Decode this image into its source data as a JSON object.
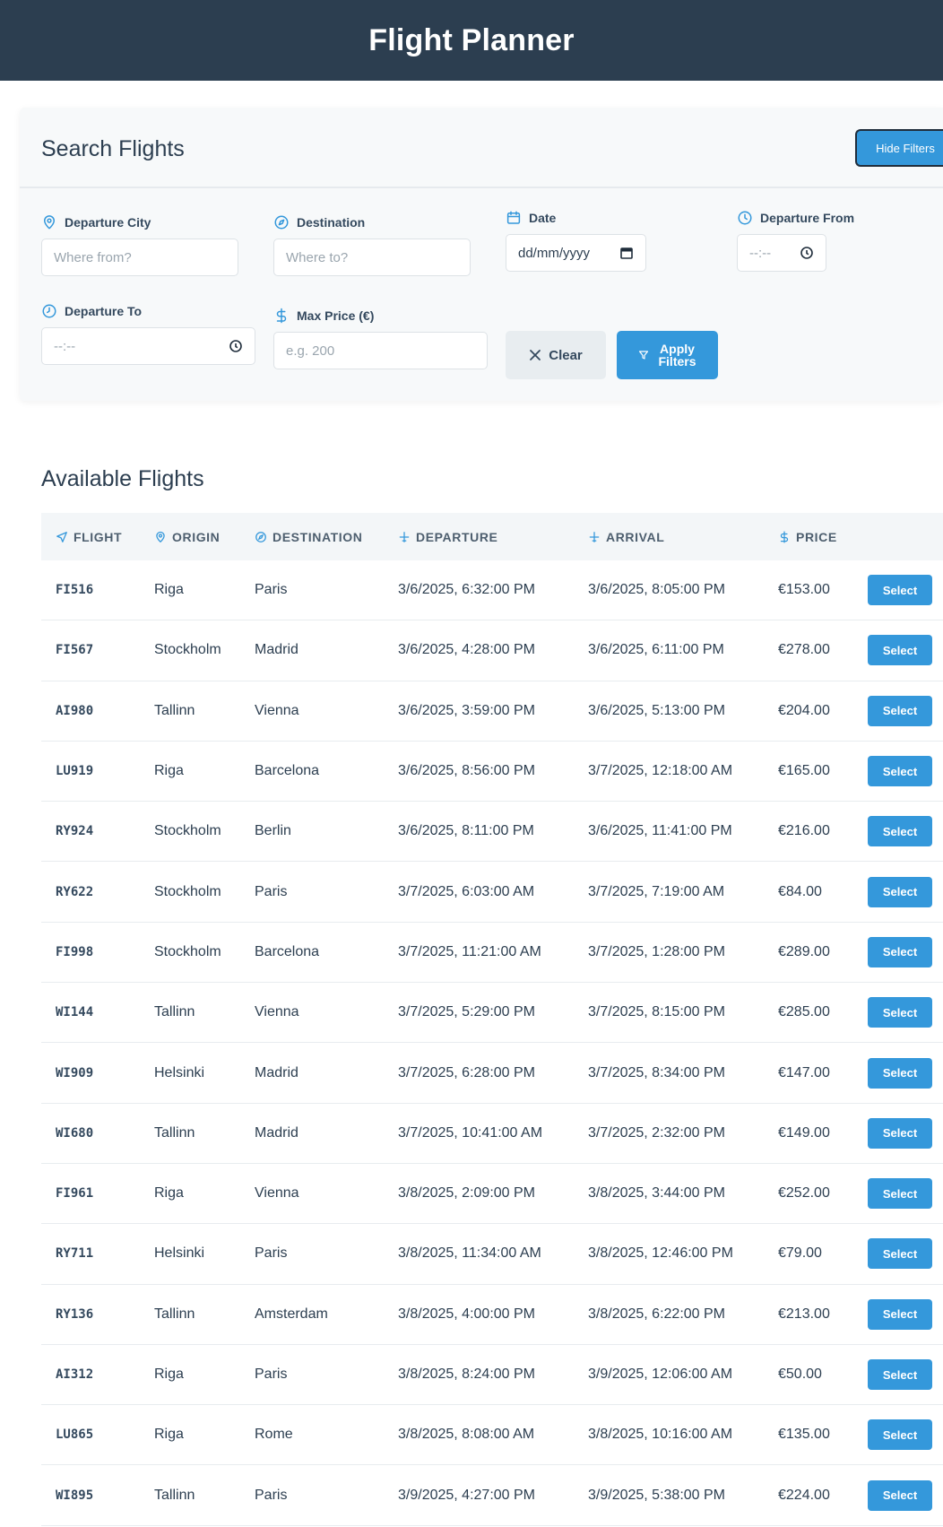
{
  "header": {
    "title": "Flight Planner"
  },
  "search": {
    "title": "Search Flights",
    "toggle_label": "Hide Filters",
    "fields": {
      "departure_city": {
        "label": "Departure City",
        "placeholder": "Where from?"
      },
      "destination": {
        "label": "Destination",
        "placeholder": "Where to?"
      },
      "date": {
        "label": "Date",
        "placeholder": "dd/mm/yyyy"
      },
      "departure_from": {
        "label": "Departure From",
        "placeholder": "--:--"
      },
      "departure_to": {
        "label": "Departure To",
        "placeholder": "--:--"
      },
      "max_price": {
        "label": "Max Price (€)",
        "placeholder": "e.g. 200"
      }
    },
    "clear_label": "Clear",
    "apply_label": "Apply Filters"
  },
  "results": {
    "title": "Available Flights",
    "columns": [
      "FLIGHT",
      "ORIGIN",
      "DESTINATION",
      "DEPARTURE",
      "ARRIVAL",
      "PRICE"
    ],
    "select_label": "Select",
    "rows": [
      {
        "flight": "FI516",
        "origin": "Riga",
        "destination": "Paris",
        "departure": "3/6/2025, 6:32:00 PM",
        "arrival": "3/6/2025, 8:05:00 PM",
        "price": "€153.00"
      },
      {
        "flight": "FI567",
        "origin": "Stockholm",
        "destination": "Madrid",
        "departure": "3/6/2025, 4:28:00 PM",
        "arrival": "3/6/2025, 6:11:00 PM",
        "price": "€278.00"
      },
      {
        "flight": "AI980",
        "origin": "Tallinn",
        "destination": "Vienna",
        "departure": "3/6/2025, 3:59:00 PM",
        "arrival": "3/6/2025, 5:13:00 PM",
        "price": "€204.00"
      },
      {
        "flight": "LU919",
        "origin": "Riga",
        "destination": "Barcelona",
        "departure": "3/6/2025, 8:56:00 PM",
        "arrival": "3/7/2025, 12:18:00 AM",
        "price": "€165.00"
      },
      {
        "flight": "RY924",
        "origin": "Stockholm",
        "destination": "Berlin",
        "departure": "3/6/2025, 8:11:00 PM",
        "arrival": "3/6/2025, 11:41:00 PM",
        "price": "€216.00"
      },
      {
        "flight": "RY622",
        "origin": "Stockholm",
        "destination": "Paris",
        "departure": "3/7/2025, 6:03:00 AM",
        "arrival": "3/7/2025, 7:19:00 AM",
        "price": "€84.00"
      },
      {
        "flight": "FI998",
        "origin": "Stockholm",
        "destination": "Barcelona",
        "departure": "3/7/2025, 11:21:00 AM",
        "arrival": "3/7/2025, 1:28:00 PM",
        "price": "€289.00"
      },
      {
        "flight": "WI144",
        "origin": "Tallinn",
        "destination": "Vienna",
        "departure": "3/7/2025, 5:29:00 PM",
        "arrival": "3/7/2025, 8:15:00 PM",
        "price": "€285.00"
      },
      {
        "flight": "WI909",
        "origin": "Helsinki",
        "destination": "Madrid",
        "departure": "3/7/2025, 6:28:00 PM",
        "arrival": "3/7/2025, 8:34:00 PM",
        "price": "€147.00"
      },
      {
        "flight": "WI680",
        "origin": "Tallinn",
        "destination": "Madrid",
        "departure": "3/7/2025, 10:41:00 AM",
        "arrival": "3/7/2025, 2:32:00 PM",
        "price": "€149.00"
      },
      {
        "flight": "FI961",
        "origin": "Riga",
        "destination": "Vienna",
        "departure": "3/8/2025, 2:09:00 PM",
        "arrival": "3/8/2025, 3:44:00 PM",
        "price": "€252.00"
      },
      {
        "flight": "RY711",
        "origin": "Helsinki",
        "destination": "Paris",
        "departure": "3/8/2025, 11:34:00 AM",
        "arrival": "3/8/2025, 12:46:00 PM",
        "price": "€79.00"
      },
      {
        "flight": "RY136",
        "origin": "Tallinn",
        "destination": "Amsterdam",
        "departure": "3/8/2025, 4:00:00 PM",
        "arrival": "3/8/2025, 6:22:00 PM",
        "price": "€213.00"
      },
      {
        "flight": "AI312",
        "origin": "Riga",
        "destination": "Paris",
        "departure": "3/8/2025, 8:24:00 PM",
        "arrival": "3/9/2025, 12:06:00 AM",
        "price": "€50.00"
      },
      {
        "flight": "LU865",
        "origin": "Riga",
        "destination": "Rome",
        "departure": "3/8/2025, 8:08:00 AM",
        "arrival": "3/8/2025, 10:16:00 AM",
        "price": "€135.00"
      },
      {
        "flight": "WI895",
        "origin": "Tallinn",
        "destination": "Paris",
        "departure": "3/9/2025, 4:27:00 PM",
        "arrival": "3/9/2025, 5:38:00 PM",
        "price": "€224.00"
      }
    ]
  },
  "icons": {
    "pin": "map-pin-icon",
    "compass": "compass-icon",
    "calendar": "calendar-icon",
    "clock": "clock-icon",
    "dollar": "dollar-icon",
    "plane": "plane-icon",
    "close": "close-icon",
    "filter": "filter-icon"
  },
  "colors": {
    "header_bg": "#2c3e50",
    "accent": "#3498db",
    "card_bg": "#f7f9fa"
  }
}
